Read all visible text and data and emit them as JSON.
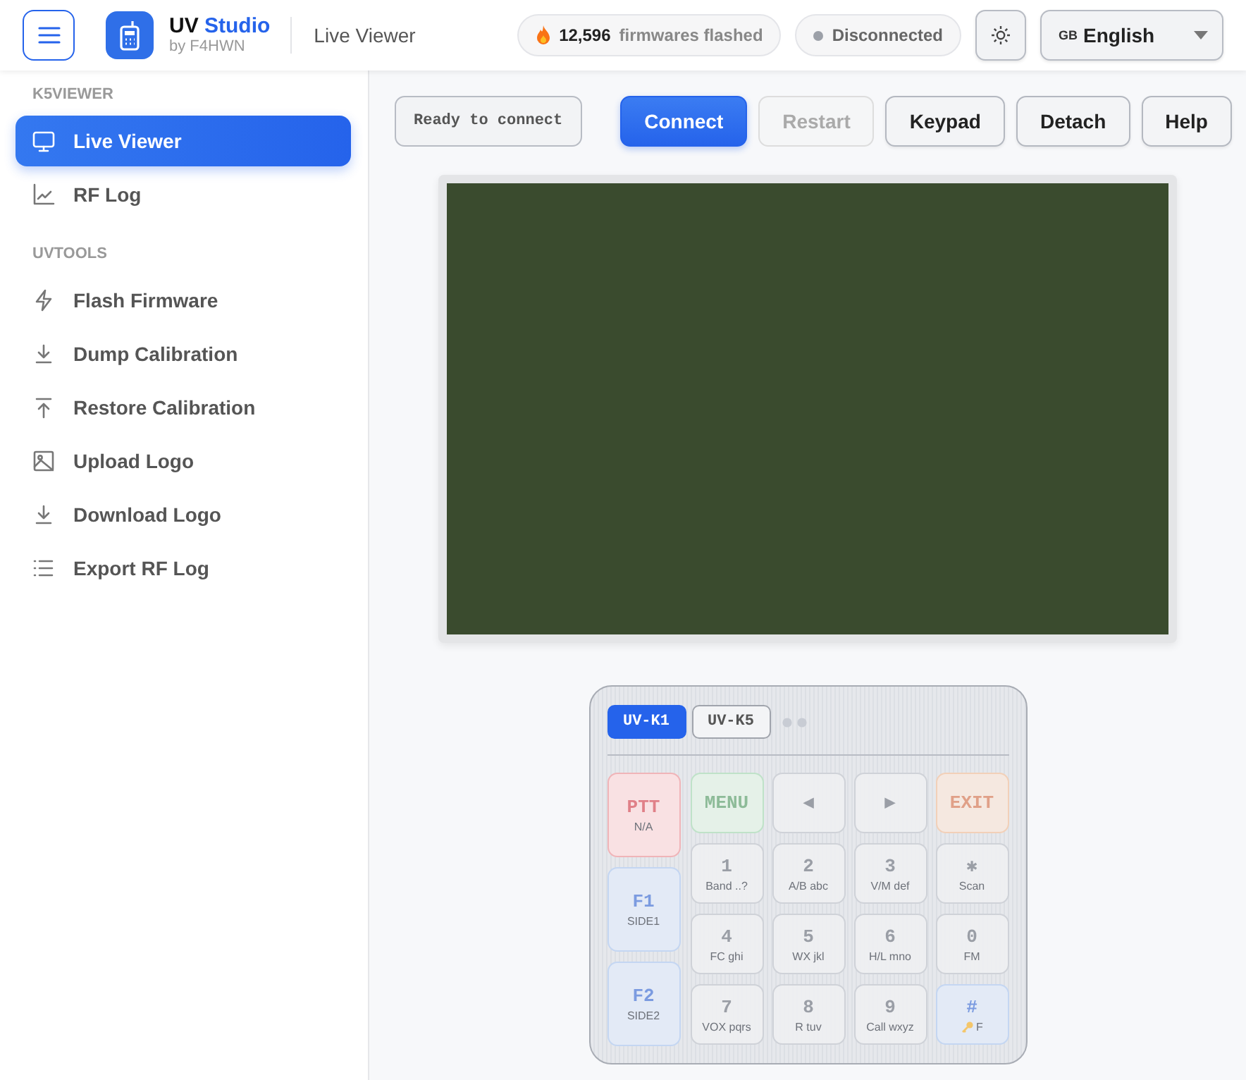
{
  "header": {
    "brand_main": "UV",
    "brand_accent": "Studio",
    "brand_sub": "by F4HWN",
    "page_title": "Live Viewer",
    "counter": {
      "value": "12,596",
      "label": "firmwares flashed"
    },
    "connection": {
      "label": "Disconnected",
      "connected": false
    },
    "language": {
      "flag": "GB",
      "label": "English"
    }
  },
  "sidebar": {
    "sections": [
      {
        "title": "K5VIEWER",
        "items": [
          {
            "label": "Live Viewer",
            "selected": true
          },
          {
            "label": "RF Log",
            "selected": false
          }
        ]
      },
      {
        "title": "UVTOOLS",
        "items": [
          {
            "label": "Flash Firmware",
            "selected": false
          },
          {
            "label": "Dump Calibration",
            "selected": false
          },
          {
            "label": "Restore Calibration",
            "selected": false
          },
          {
            "label": "Upload Logo",
            "selected": false
          },
          {
            "label": "Download Logo",
            "selected": false
          },
          {
            "label": "Export RF Log",
            "selected": false
          }
        ]
      }
    ]
  },
  "toolbar": {
    "status": "Ready to connect",
    "buttons": [
      {
        "label": "Connect",
        "kind": "primary",
        "disabled": false
      },
      {
        "label": "Restart",
        "kind": "normal",
        "disabled": true
      },
      {
        "label": "Keypad",
        "kind": "normal",
        "disabled": false
      },
      {
        "label": "Detach",
        "kind": "normal",
        "disabled": false
      },
      {
        "label": "Help",
        "kind": "normal",
        "disabled": false
      }
    ]
  },
  "keypad": {
    "models": [
      {
        "label": "UV-K1",
        "selected": true
      },
      {
        "label": "UV-K5",
        "selected": false
      }
    ],
    "side_keys": [
      {
        "label": "PTT",
        "sub": "N/A",
        "kind": "ptt"
      },
      {
        "label": "F1",
        "sub": "SIDE1",
        "kind": "side"
      },
      {
        "label": "F2",
        "sub": "SIDE2",
        "kind": "side"
      }
    ],
    "keys": [
      {
        "label": "MENU",
        "kind": "menu"
      },
      {
        "label": "◀",
        "kind": "normal"
      },
      {
        "label": "▶",
        "kind": "normal"
      },
      {
        "label": "EXIT",
        "kind": "exit"
      },
      {
        "label": "1",
        "sub": "Band ..?",
        "kind": "normal"
      },
      {
        "label": "2",
        "sub": "A/B abc",
        "kind": "normal"
      },
      {
        "label": "3",
        "sub": "V/M def",
        "kind": "normal"
      },
      {
        "label": "✱",
        "sub": "Scan",
        "kind": "normal"
      },
      {
        "label": "4",
        "sub": "FC ghi",
        "kind": "normal"
      },
      {
        "label": "5",
        "sub": "WX jkl",
        "kind": "normal"
      },
      {
        "label": "6",
        "sub": "H/L mno",
        "kind": "normal"
      },
      {
        "label": "0",
        "sub": "FM",
        "kind": "normal"
      },
      {
        "label": "7",
        "sub": "VOX pqrs",
        "kind": "normal"
      },
      {
        "label": "8",
        "sub": "R tuv",
        "kind": "normal"
      },
      {
        "label": "9",
        "sub": "Call wxyz",
        "kind": "normal"
      },
      {
        "label": "#",
        "sub": "F",
        "kind": "hash"
      }
    ]
  }
}
